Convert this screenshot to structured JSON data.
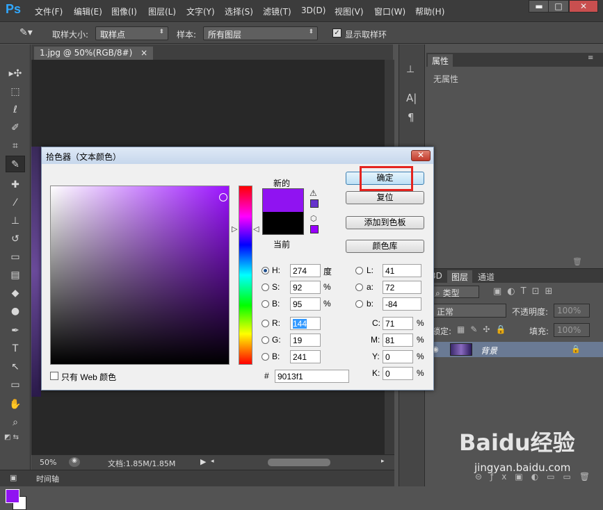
{
  "app": {
    "logo": "Ps"
  },
  "menu": [
    "文件(F)",
    "编辑(E)",
    "图像(I)",
    "图层(L)",
    "文字(Y)",
    "选择(S)",
    "滤镜(T)",
    "3D(D)",
    "视图(V)",
    "窗口(W)",
    "帮助(H)"
  ],
  "window_controls": {
    "minimize": "▬",
    "maximize": "□",
    "close": "✕"
  },
  "options_bar": {
    "sample_size_label": "取样大小:",
    "sample_size_value": "取样点",
    "sample_label": "样本:",
    "sample_value": "所有图层",
    "show_ring_label": "显示取样环",
    "show_ring_checked": true
  },
  "document": {
    "tab_label": "1.jpg @ 50%(RGB/8#)",
    "tab_close": "×",
    "zoom": "50%",
    "doc_info": "文档:1.85M/1.85M",
    "timeline_label": "时间轴"
  },
  "properties_panel": {
    "tab": "属性",
    "empty_text": "无属性"
  },
  "layers_panel": {
    "tabs": [
      "3D",
      "图层",
      "通道"
    ],
    "kind_label": "类型",
    "blend_mode": "正常",
    "opacity_label": "不透明度:",
    "opacity_value": "100%",
    "lock_label": "锁定:",
    "fill_label": "填充:",
    "fill_value": "100%",
    "layer_name": "背景"
  },
  "dialog": {
    "title": "拾色器（文本颜色）",
    "close": "✕",
    "new_label": "新的",
    "current_label": "当前",
    "new_color": "#9013f1",
    "current_color": "#000000",
    "buttons": {
      "ok": "确定",
      "reset": "复位",
      "add_swatch": "添加到色板",
      "libraries": "颜色库"
    },
    "hsb": [
      {
        "label": "H:",
        "value": "274",
        "unit": "度",
        "checked": true
      },
      {
        "label": "S:",
        "value": "92",
        "unit": "%",
        "checked": false
      },
      {
        "label": "B:",
        "value": "95",
        "unit": "%",
        "checked": false
      }
    ],
    "rgb": [
      {
        "label": "R:",
        "value": "144",
        "checked": false
      },
      {
        "label": "G:",
        "value": "19",
        "checked": false
      },
      {
        "label": "B:",
        "value": "241",
        "checked": false
      }
    ],
    "lab": [
      {
        "label": "L:",
        "value": "41"
      },
      {
        "label": "a:",
        "value": "72"
      },
      {
        "label": "b:",
        "value": "-84"
      }
    ],
    "cmyk": [
      {
        "label": "C:",
        "value": "71",
        "unit": "%"
      },
      {
        "label": "M:",
        "value": "81",
        "unit": "%"
      },
      {
        "label": "Y:",
        "value": "0",
        "unit": "%"
      },
      {
        "label": "K:",
        "value": "0",
        "unit": "%"
      }
    ],
    "web_only_label": "只有 Web 颜色",
    "hex_label": "#",
    "hex_value": "9013f1"
  },
  "watermark": {
    "logo": "Baidu经验",
    "url": "jingyan.baidu.com"
  }
}
